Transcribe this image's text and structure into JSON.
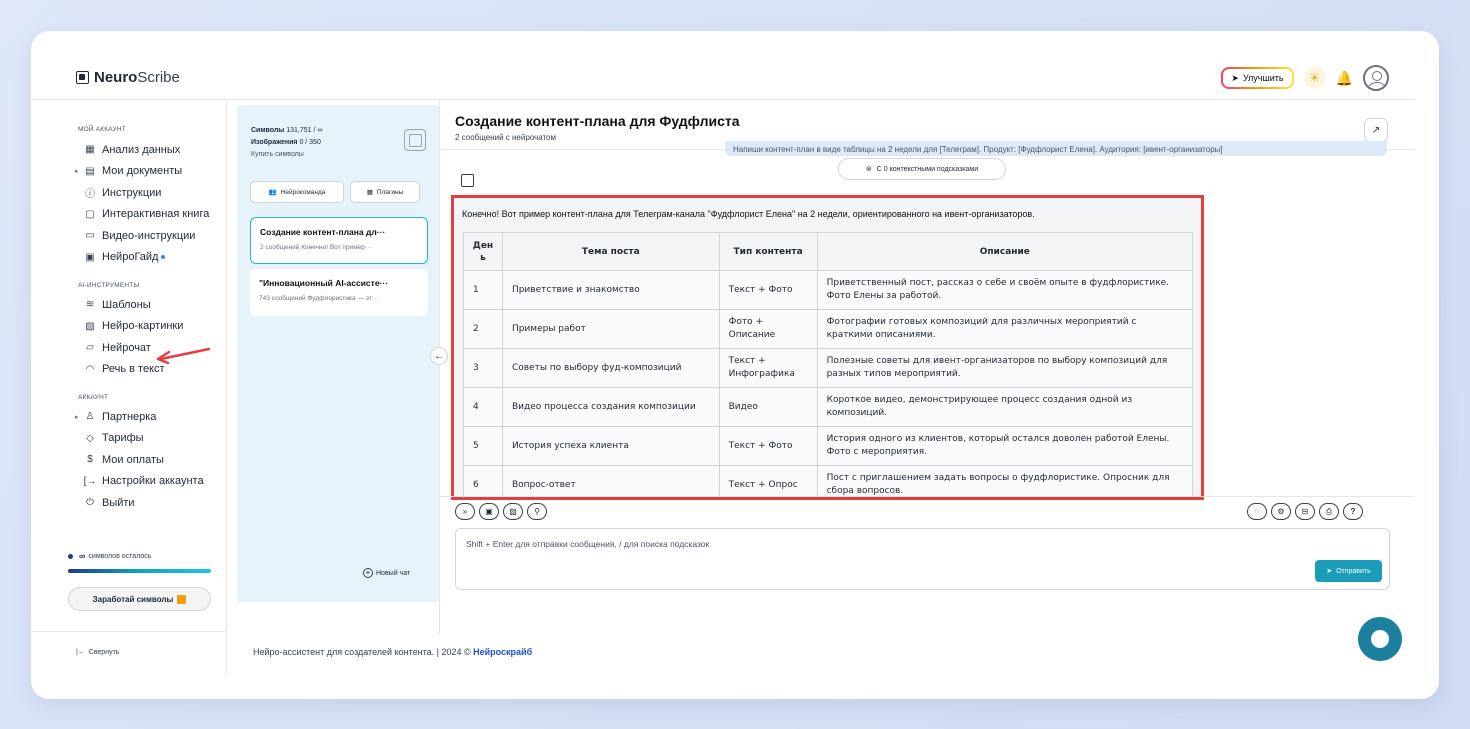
{
  "app": {
    "brand_bold": "Neuro",
    "brand_rest": "Scribe",
    "upgrade_label": "Улучшить"
  },
  "sidebar": {
    "sections": [
      {
        "title": "Мой аккаунт",
        "items": [
          {
            "label": "Анализ данных",
            "icon": "grid-icon"
          },
          {
            "label": "Мои документы",
            "icon": "document-icon",
            "caret": true
          },
          {
            "label": "Инструкции",
            "icon": "help-circle-icon"
          },
          {
            "label": "Интерактивная книга",
            "icon": "book-icon"
          },
          {
            "label": "Видео-инструкции",
            "icon": "video-icon"
          },
          {
            "label": "НейроГайд",
            "icon": "guide-icon",
            "dot": true
          }
        ]
      },
      {
        "title": "AI-инструменты",
        "items": [
          {
            "label": "Шаблоны",
            "icon": "layers-icon"
          },
          {
            "label": "Нейро-картинки",
            "icon": "image-icon"
          },
          {
            "label": "Нейрочат",
            "icon": "chat-icon"
          },
          {
            "label": "Речь в текст",
            "icon": "headphones-icon"
          }
        ]
      },
      {
        "title": "Аккаунт",
        "items": [
          {
            "label": "Партнерка",
            "icon": "users-icon",
            "caret": true
          },
          {
            "label": "Тарифы",
            "icon": "tag-icon"
          },
          {
            "label": "Мои оплаты",
            "icon": "dollar-icon"
          },
          {
            "label": "Настройки аккаунта",
            "icon": "login-icon"
          },
          {
            "label": "Выйти",
            "icon": "power-icon"
          }
        ]
      }
    ],
    "symbols_left": "символов осталось",
    "symbols_infinity": "∞",
    "earn_label": "Заработай символы",
    "collapse_label": "Свернуть"
  },
  "panel": {
    "symbols_label": "Символы",
    "symbols_value": "131,751 / ∞",
    "images_label": "Изображения",
    "images_value": "0 / 350",
    "buy_label": "Купить символы",
    "team_button": "Нейрокоманда",
    "plugins_button": "Плагины",
    "chats": [
      {
        "title": "Создание контент-плана дл···",
        "subtitle": "2 сообщений     Конечно! Вот пример···",
        "active": true
      },
      {
        "title": "\"Инновационный AI-ассисте···",
        "subtitle": "743 сообщений Фудфлористика — эт···",
        "active": false
      }
    ],
    "new_chat": "Новый чат"
  },
  "chat": {
    "title": "Создание контент-плана для Фудфлиста",
    "subtitle": "2 сообщений с нейрочатом",
    "user_message": "Напиши контент-план в виде таблицы на 2 недели для [Телеграм]. Продукт: [Фудфлорист Елена]. Аудитория: [ивент-организаторы]",
    "context_pill": "С 0 контекстными подсказками",
    "intro": "Конечно! Вот пример контент-плана для Телеграм-канала \"Фудфлорист Елена\" на 2 недели, ориентированного на ивент-организаторов.",
    "table_headers": [
      "День",
      "Тема поста",
      "Тип контента",
      "Описание"
    ],
    "rows": [
      {
        "day": "1",
        "topic": "Приветствие и знакомство",
        "type": "Текст + Фото",
        "desc": "Приветственный пост, рассказ о себе и своём опыте в фудфлористике. Фото Елены за работой."
      },
      {
        "day": "2",
        "topic": "Примеры работ",
        "type": "Фото + Описание",
        "desc": "Фотографии готовых композиций для различных мероприятий с краткими описаниями."
      },
      {
        "day": "3",
        "topic": "Советы по выбору фуд-композиций",
        "type": "Текст + Инфографика",
        "desc": "Полезные советы для ивент-организаторов по выбору композиций для разных типов мероприятий."
      },
      {
        "day": "4",
        "topic": "Видео процесса создания композиции",
        "type": "Видео",
        "desc": "Короткое видео, демонстрирующее процесс создания одной из композиций."
      },
      {
        "day": "5",
        "topic": "История успеха клиента",
        "type": "Текст + Фото",
        "desc": "История одного из клиентов, который остался доволен работой Елены. Фото с мероприятия."
      },
      {
        "day": "6",
        "topic": "Вопрос-ответ",
        "type": "Текст + Опрос",
        "desc": "Пост с приглашением задать вопросы о фудфлористике. Опросник для сбора вопросов."
      }
    ],
    "input_placeholder": "Shift + Enter для отправки сообщения, / для поиска подсказок",
    "send_label": "Отправить"
  },
  "footer": {
    "text": "Нейро-ассистент для создателей контента.  | 2024 © ",
    "link": "Нейроскрайб"
  }
}
